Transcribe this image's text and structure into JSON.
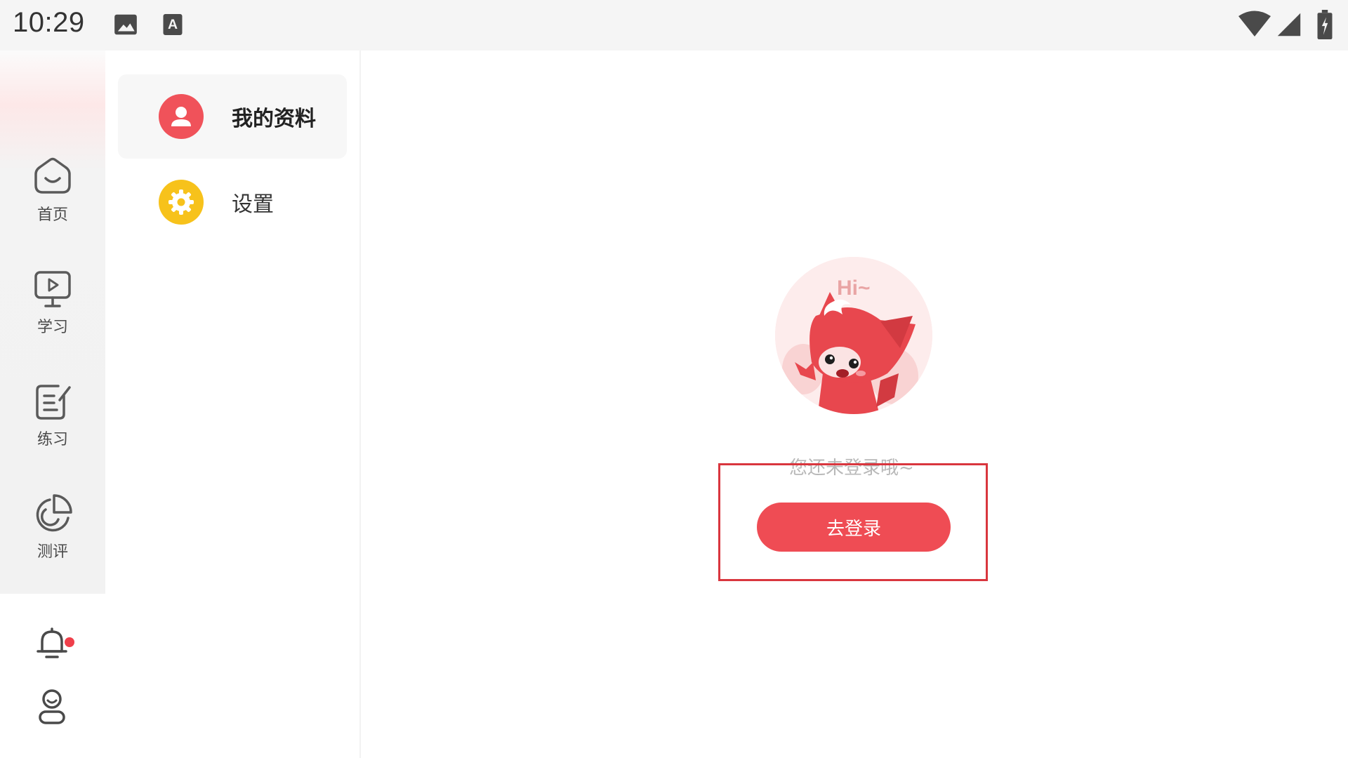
{
  "status_bar": {
    "time": "10:29",
    "icons": [
      "image-icon",
      "keyboard-a-icon",
      "wifi-icon",
      "signal-icon",
      "battery-charging-icon"
    ]
  },
  "nav": {
    "items": [
      {
        "label": "首页",
        "icon": "home-icon"
      },
      {
        "label": "学习",
        "icon": "monitor-play-icon"
      },
      {
        "label": "练习",
        "icon": "notes-edit-icon"
      },
      {
        "label": "测评",
        "icon": "pie-chart-icon"
      }
    ],
    "bottom": [
      {
        "icon": "bell-icon"
      },
      {
        "icon": "user-icon",
        "badge_color": "#ef3f4a"
      }
    ]
  },
  "menu": {
    "items": [
      {
        "label": "我的资料",
        "icon": "profile-icon",
        "icon_color": "#f0525a",
        "active": true
      },
      {
        "label": "设置",
        "icon": "gear-icon",
        "icon_color": "#f7c21b",
        "active": false
      }
    ]
  },
  "main": {
    "avatar_greeting": "Hi~",
    "not_logged_in_text": "您还未登录哦~",
    "login_button_label": "去登录",
    "accent_color": "#ef4c54"
  }
}
